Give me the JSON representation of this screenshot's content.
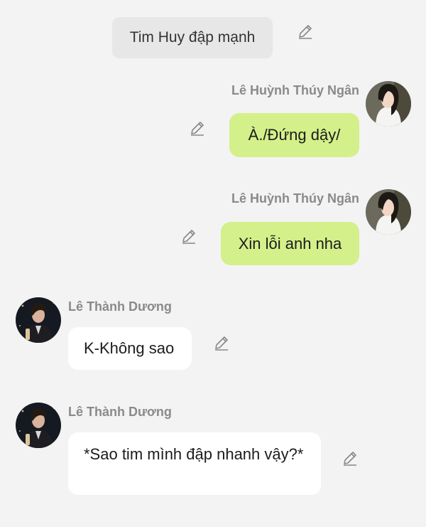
{
  "system_message": {
    "text": "Tim Huy đập mạnh"
  },
  "messages": [
    {
      "sender": "Lê Huỳnh Thúy Ngân",
      "text": "À./Đứng dậy/",
      "side": "right"
    },
    {
      "sender": "Lê Huỳnh Thúy Ngân",
      "text": "Xin lỗi anh nha",
      "side": "right"
    },
    {
      "sender": "Lê Thành Dương",
      "text": "K-Không sao",
      "side": "left"
    },
    {
      "sender": "Lê Thành Dương",
      "text": "*Sao tim mình đập nhanh vậy?*",
      "side": "left"
    }
  ],
  "colors": {
    "background": "#f3f3f3",
    "system_bubble": "#e7e7e7",
    "my_bubble": "#d4f08a",
    "other_bubble": "#ffffff",
    "sender_name": "#8a8a8a"
  },
  "icons": {
    "edit": "pencil-icon"
  }
}
